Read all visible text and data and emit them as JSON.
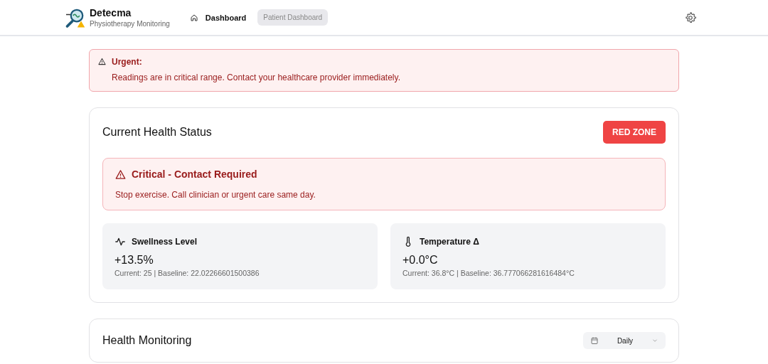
{
  "header": {
    "brand": "Detecma",
    "subtitle": "Physiotherapy Monitoring",
    "nav": [
      {
        "kind": "home",
        "label": "Dashboard",
        "selected": false
      },
      {
        "kind": "plain",
        "label": "Patient Dashboard",
        "selected": true
      }
    ]
  },
  "alert": {
    "title": "Urgent:",
    "message": "Readings are in critical range. Contact your healthcare provider immediately."
  },
  "status_card": {
    "title": "Current Health Status",
    "zone": "RED ZONE",
    "notice": {
      "title": "Critical - Contact Required",
      "message": "Stop exercise. Call clinician or urgent care same day."
    },
    "metrics": [
      {
        "kind": "activity",
        "label": "Swellness Level",
        "value": "+13.5%",
        "detail": "Current: 25 | Baseline: 22.02266601500386"
      },
      {
        "kind": "thermometer",
        "label": "Temperature Δ",
        "value": "+0.0°C",
        "detail": "Current: 36.8°C | Baseline: 36.777066281616484°C"
      }
    ]
  },
  "monitoring_card": {
    "title": "Health Monitoring",
    "period": "Daily"
  }
}
